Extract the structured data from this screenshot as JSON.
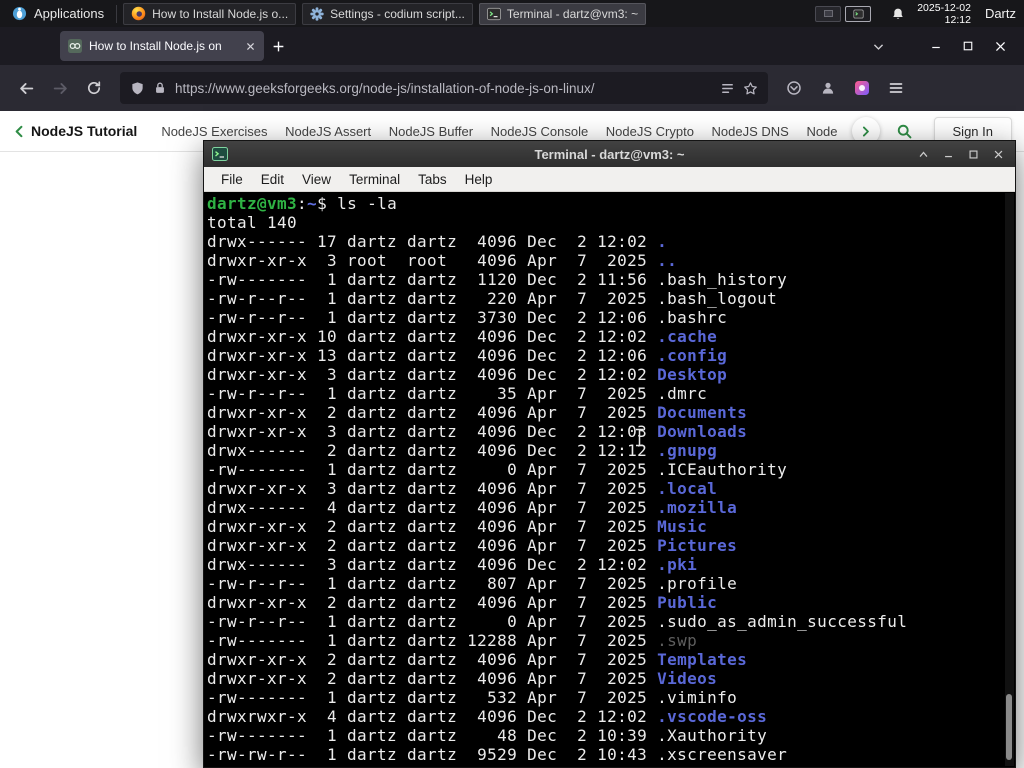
{
  "panel": {
    "applications_label": "Applications",
    "tasks": [
      {
        "label": "How to Install Node.js o...",
        "icon": "firefox-icon"
      },
      {
        "label": "Settings - codium script...",
        "icon": "settings-gear-icon"
      },
      {
        "label": "Terminal - dartz@vm3: ~",
        "icon": "terminal-icon"
      }
    ],
    "clock": {
      "date": "2025-12-02",
      "time": "12:12"
    },
    "user_label": "Dartz"
  },
  "browser": {
    "tab": {
      "title": "How to Install Node.js on"
    },
    "url": "https://www.geeksforgeeks.org/node-js/installation-of-node-js-on-linux/"
  },
  "site_nav": {
    "title": "NodeJS Tutorial",
    "items": [
      "NodeJS Exercises",
      "NodeJS Assert",
      "NodeJS Buffer",
      "NodeJS Console",
      "NodeJS Crypto",
      "NodeJS DNS",
      "Node"
    ],
    "sign_in_label": "Sign In"
  },
  "terminal": {
    "title": "Terminal - dartz@vm3: ~",
    "menu": [
      "File",
      "Edit",
      "View",
      "Terminal",
      "Tabs",
      "Help"
    ],
    "prompt": {
      "user": "dartz@vm3",
      "separator": ":",
      "path": "~",
      "symbol": "$"
    },
    "command": "ls -la",
    "total_line": "total 140",
    "files": [
      {
        "perms": "drwx------",
        "links": "17",
        "owner": "dartz",
        "group": "dartz",
        "size": "4096",
        "month": "Dec",
        "day": "2",
        "time": "12:02",
        "name": ".",
        "type": "dir"
      },
      {
        "perms": "drwxr-xr-x",
        "links": "3",
        "owner": "root",
        "group": "root",
        "size": "4096",
        "month": "Apr",
        "day": "7",
        "time": "2025",
        "name": "..",
        "type": "dir"
      },
      {
        "perms": "-rw-------",
        "links": "1",
        "owner": "dartz",
        "group": "dartz",
        "size": "1120",
        "month": "Dec",
        "day": "2",
        "time": "11:56",
        "name": ".bash_history",
        "type": "file"
      },
      {
        "perms": "-rw-r--r--",
        "links": "1",
        "owner": "dartz",
        "group": "dartz",
        "size": "220",
        "month": "Apr",
        "day": "7",
        "time": "2025",
        "name": ".bash_logout",
        "type": "file"
      },
      {
        "perms": "-rw-r--r--",
        "links": "1",
        "owner": "dartz",
        "group": "dartz",
        "size": "3730",
        "month": "Dec",
        "day": "2",
        "time": "12:06",
        "name": ".bashrc",
        "type": "file"
      },
      {
        "perms": "drwxr-xr-x",
        "links": "10",
        "owner": "dartz",
        "group": "dartz",
        "size": "4096",
        "month": "Dec",
        "day": "2",
        "time": "12:02",
        "name": ".cache",
        "type": "dir"
      },
      {
        "perms": "drwxr-xr-x",
        "links": "13",
        "owner": "dartz",
        "group": "dartz",
        "size": "4096",
        "month": "Dec",
        "day": "2",
        "time": "12:06",
        "name": ".config",
        "type": "dir"
      },
      {
        "perms": "drwxr-xr-x",
        "links": "3",
        "owner": "dartz",
        "group": "dartz",
        "size": "4096",
        "month": "Dec",
        "day": "2",
        "time": "12:02",
        "name": "Desktop",
        "type": "dir"
      },
      {
        "perms": "-rw-r--r--",
        "links": "1",
        "owner": "dartz",
        "group": "dartz",
        "size": "35",
        "month": "Apr",
        "day": "7",
        "time": "2025",
        "name": ".dmrc",
        "type": "file"
      },
      {
        "perms": "drwxr-xr-x",
        "links": "2",
        "owner": "dartz",
        "group": "dartz",
        "size": "4096",
        "month": "Apr",
        "day": "7",
        "time": "2025",
        "name": "Documents",
        "type": "dir"
      },
      {
        "perms": "drwxr-xr-x",
        "links": "3",
        "owner": "dartz",
        "group": "dartz",
        "size": "4096",
        "month": "Dec",
        "day": "2",
        "time": "12:03",
        "name": "Downloads",
        "type": "dir"
      },
      {
        "perms": "drwx------",
        "links": "2",
        "owner": "dartz",
        "group": "dartz",
        "size": "4096",
        "month": "Dec",
        "day": "2",
        "time": "12:12",
        "name": ".gnupg",
        "type": "dir"
      },
      {
        "perms": "-rw-------",
        "links": "1",
        "owner": "dartz",
        "group": "dartz",
        "size": "0",
        "month": "Apr",
        "day": "7",
        "time": "2025",
        "name": ".ICEauthority",
        "type": "file"
      },
      {
        "perms": "drwxr-xr-x",
        "links": "3",
        "owner": "dartz",
        "group": "dartz",
        "size": "4096",
        "month": "Apr",
        "day": "7",
        "time": "2025",
        "name": ".local",
        "type": "dir"
      },
      {
        "perms": "drwx------",
        "links": "4",
        "owner": "dartz",
        "group": "dartz",
        "size": "4096",
        "month": "Apr",
        "day": "7",
        "time": "2025",
        "name": ".mozilla",
        "type": "dir"
      },
      {
        "perms": "drwxr-xr-x",
        "links": "2",
        "owner": "dartz",
        "group": "dartz",
        "size": "4096",
        "month": "Apr",
        "day": "7",
        "time": "2025",
        "name": "Music",
        "type": "dir"
      },
      {
        "perms": "drwxr-xr-x",
        "links": "2",
        "owner": "dartz",
        "group": "dartz",
        "size": "4096",
        "month": "Apr",
        "day": "7",
        "time": "2025",
        "name": "Pictures",
        "type": "dir"
      },
      {
        "perms": "drwx------",
        "links": "3",
        "owner": "dartz",
        "group": "dartz",
        "size": "4096",
        "month": "Dec",
        "day": "2",
        "time": "12:02",
        "name": ".pki",
        "type": "dir"
      },
      {
        "perms": "-rw-r--r--",
        "links": "1",
        "owner": "dartz",
        "group": "dartz",
        "size": "807",
        "month": "Apr",
        "day": "7",
        "time": "2025",
        "name": ".profile",
        "type": "file"
      },
      {
        "perms": "drwxr-xr-x",
        "links": "2",
        "owner": "dartz",
        "group": "dartz",
        "size": "4096",
        "month": "Apr",
        "day": "7",
        "time": "2025",
        "name": "Public",
        "type": "dir"
      },
      {
        "perms": "-rw-r--r--",
        "links": "1",
        "owner": "dartz",
        "group": "dartz",
        "size": "0",
        "month": "Apr",
        "day": "7",
        "time": "2025",
        "name": ".sudo_as_admin_successful",
        "type": "file"
      },
      {
        "perms": "-rw-------",
        "links": "1",
        "owner": "dartz",
        "group": "dartz",
        "size": "12288",
        "month": "Apr",
        "day": "7",
        "time": "2025",
        "name": ".swp",
        "type": "dim"
      },
      {
        "perms": "drwxr-xr-x",
        "links": "2",
        "owner": "dartz",
        "group": "dartz",
        "size": "4096",
        "month": "Apr",
        "day": "7",
        "time": "2025",
        "name": "Templates",
        "type": "dir"
      },
      {
        "perms": "drwxr-xr-x",
        "links": "2",
        "owner": "dartz",
        "group": "dartz",
        "size": "4096",
        "month": "Apr",
        "day": "7",
        "time": "2025",
        "name": "Videos",
        "type": "dir"
      },
      {
        "perms": "-rw-------",
        "links": "1",
        "owner": "dartz",
        "group": "dartz",
        "size": "532",
        "month": "Apr",
        "day": "7",
        "time": "2025",
        "name": ".viminfo",
        "type": "file"
      },
      {
        "perms": "drwxrwxr-x",
        "links": "4",
        "owner": "dartz",
        "group": "dartz",
        "size": "4096",
        "month": "Dec",
        "day": "2",
        "time": "12:02",
        "name": ".vscode-oss",
        "type": "dir"
      },
      {
        "perms": "-rw-------",
        "links": "1",
        "owner": "dartz",
        "group": "dartz",
        "size": "48",
        "month": "Dec",
        "day": "2",
        "time": "10:39",
        "name": ".Xauthority",
        "type": "file"
      },
      {
        "perms": "-rw-rw-r--",
        "links": "1",
        "owner": "dartz",
        "group": "dartz",
        "size": "9529",
        "month": "Dec",
        "day": "2",
        "time": "10:43",
        "name": ".xscreensaver",
        "type": "file"
      }
    ]
  },
  "colors": {
    "site_accent_green": "#2f8d46",
    "terminal_dir_blue": "#5a68d8",
    "terminal_prompt_green": "#2fb344",
    "terminal_dim_gray": "#5e5e5e"
  }
}
